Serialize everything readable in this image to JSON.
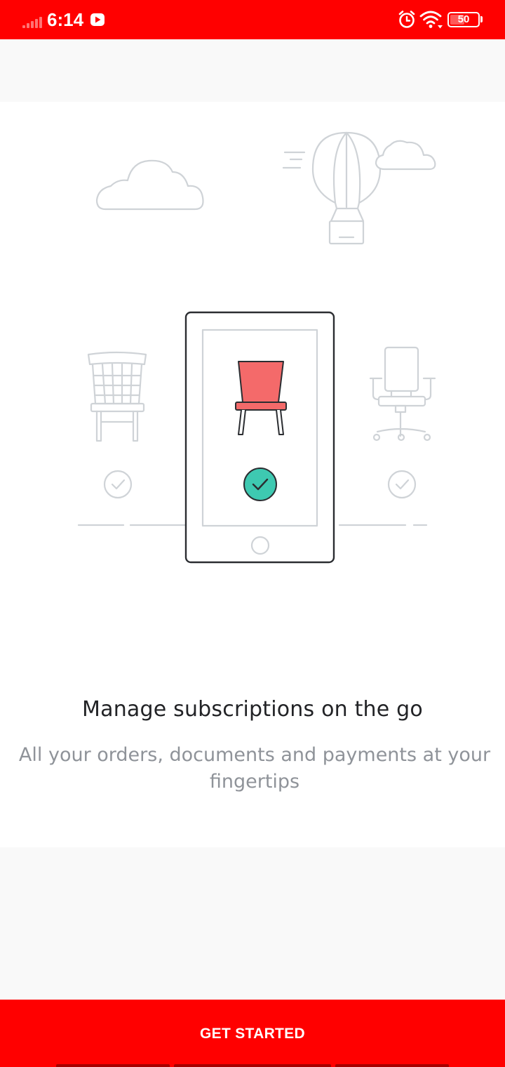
{
  "status_bar": {
    "time": "6:14",
    "battery_level": "50",
    "color": "#ff0000",
    "icons": [
      "signal-icon",
      "youtube-icon",
      "alarm-icon",
      "wifi-icon",
      "battery-icon"
    ]
  },
  "onboarding": {
    "title": "Manage subscriptions on the go",
    "subtitle": "All your orders, documents and payments at your fingertips"
  },
  "illustration": {
    "icons": [
      "cloud-icon",
      "hot-air-balloon-icon",
      "phone-icon",
      "chair-icon",
      "check-circle-icon",
      "office-chair-icon"
    ],
    "accent_chair_color": "#f46a6a",
    "accent_check_color": "#3ec9b1"
  },
  "footer": {
    "cta_label": "GET STARTED",
    "cta_color": "#ff0000"
  }
}
